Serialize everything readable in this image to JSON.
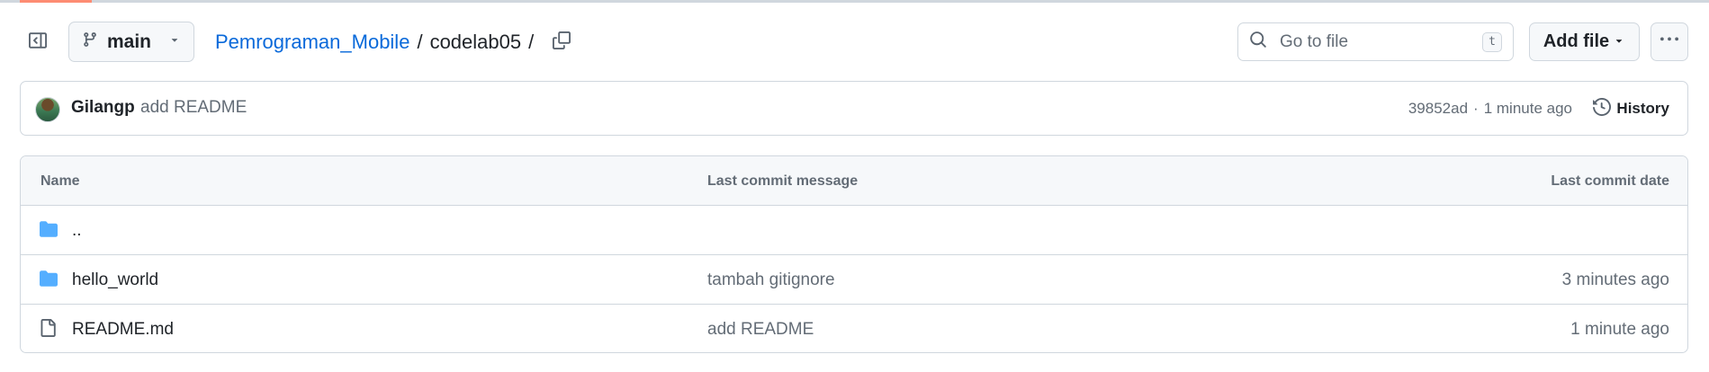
{
  "header": {
    "branch": "main",
    "breadcrumb": {
      "repo": "Pemrograman_Mobile",
      "separator": "/",
      "folder": "codelab05",
      "trailing_separator": "/"
    },
    "search": {
      "placeholder": "Go to file",
      "shortcut": "t"
    },
    "add_file_label": "Add file"
  },
  "commit": {
    "author": "Gilangp",
    "message": "add README",
    "hash": "39852ad",
    "meta_separator": "·",
    "time": "1 minute ago",
    "history_label": "History"
  },
  "table": {
    "headers": {
      "name": "Name",
      "message": "Last commit message",
      "date": "Last commit date"
    },
    "rows": [
      {
        "type": "folder",
        "name": "..",
        "message": "",
        "date": ""
      },
      {
        "type": "folder",
        "name": "hello_world",
        "message": "tambah gitignore",
        "date": "3 minutes ago"
      },
      {
        "type": "file",
        "name": "README.md",
        "message": "add README",
        "date": "1 minute ago"
      }
    ]
  },
  "colors": {
    "link": "#0969da",
    "folder_icon": "#54aeff",
    "muted_text": "#636c76",
    "border": "#d0d7de",
    "accent_underline": "#fd8c73"
  },
  "icons": {
    "panel": "sidebar-expand-icon",
    "branch": "git-branch-icon",
    "copy": "copy-icon",
    "search": "search-icon",
    "more": "kebab-horizontal-icon",
    "history": "history-icon",
    "folder": "folder-icon",
    "file": "file-icon"
  }
}
